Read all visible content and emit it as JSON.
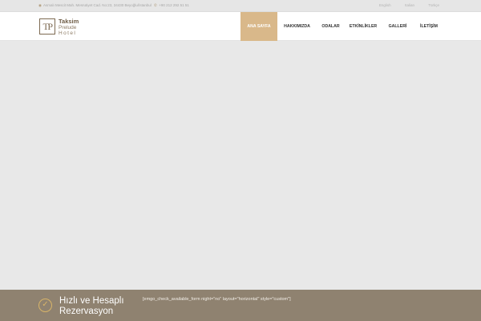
{
  "topbar": {
    "address": "Asmalı Mescit Mah. Mesrutiyet Cad. No:23, 34430 Beyoğlu/İstanbul",
    "phone": "+90 212 292 51 51",
    "languages": [
      "English",
      "Italian",
      "Türkçe"
    ]
  },
  "logo": {
    "mark": "TP",
    "line1": "Taksim",
    "line2": "Prelude",
    "line3": "Hotel"
  },
  "nav": {
    "items": [
      {
        "label": "ANA SAYFA",
        "active": true
      },
      {
        "label": "HAKKIMIZDA"
      },
      {
        "label": "ODALAR"
      },
      {
        "label": "ETKİNLİKLER"
      },
      {
        "label": "GALLERİ"
      },
      {
        "label": "İLETİŞİM"
      }
    ]
  },
  "booking": {
    "title_line1": "Hızlı ve Hesaplı",
    "title_line2": "Rezervasyon",
    "shortcode": "[emgo_check_available_form night=\"no\" layout=\"horizontal\" style=\"custom\"]"
  },
  "colors": {
    "accent": "#d9b88a",
    "booking_bar": "#8f8270",
    "check_icon": "#d8b468"
  },
  "icons": {
    "address": "map-pin-icon",
    "phone": "phone-icon",
    "booking": "check-circle-icon"
  }
}
